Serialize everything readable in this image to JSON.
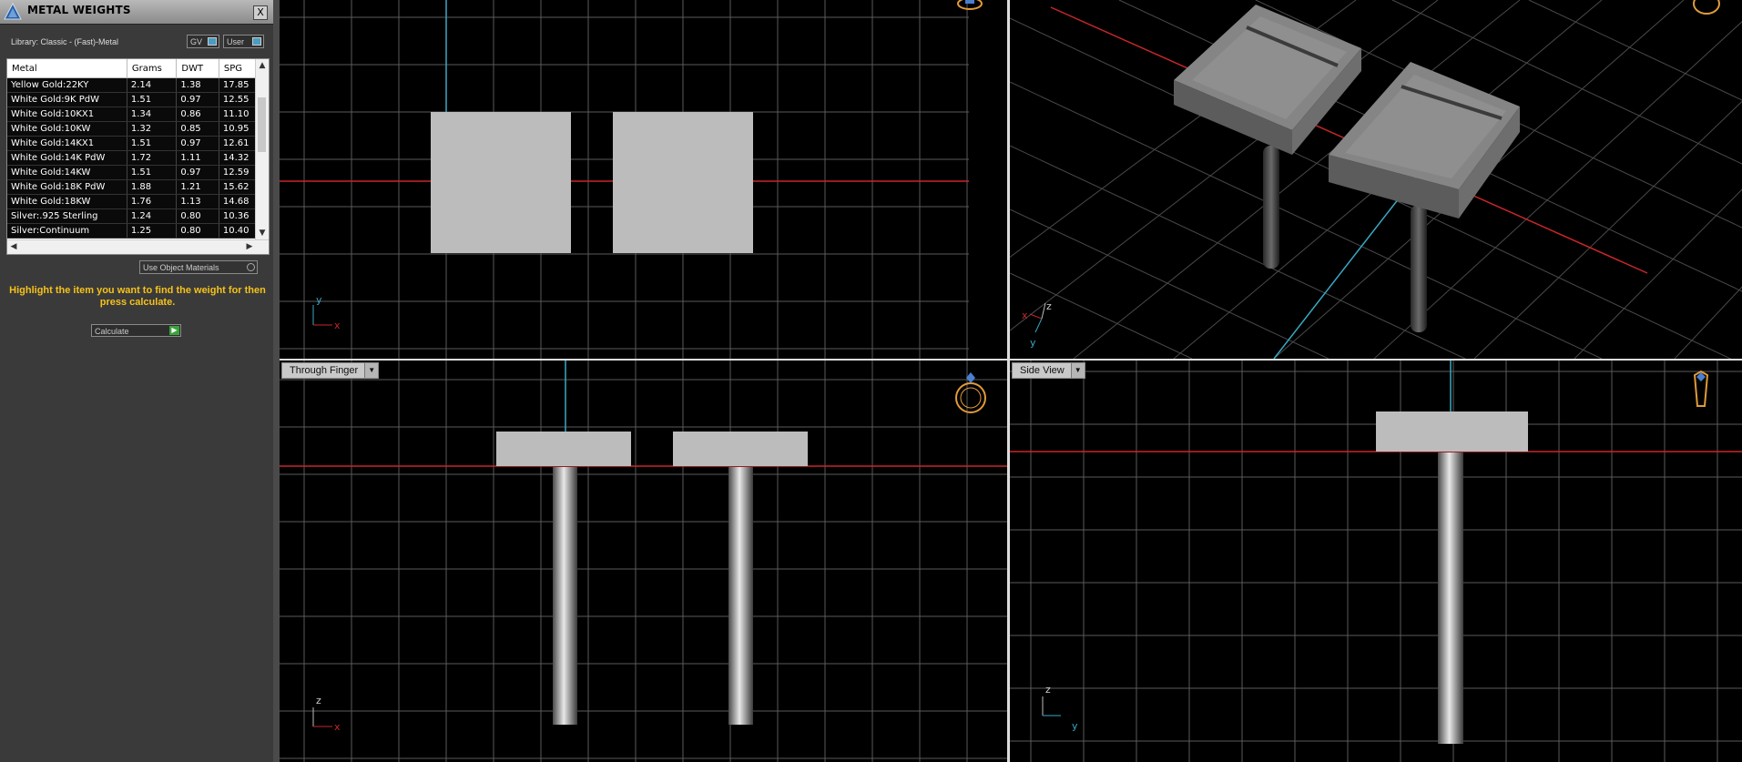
{
  "panel": {
    "title": "METAL WEIGHTS",
    "close_glyph": "X",
    "library": "Library: Classic - (Fast)-Metal",
    "gv_label": "GV",
    "user_label": "User",
    "columns": [
      "Metal",
      "Grams",
      "DWT",
      "SPG"
    ],
    "rows": [
      [
        "Yellow Gold:22KY",
        "2.14",
        "1.38",
        "17.85"
      ],
      [
        "White Gold:9K PdW",
        "1.51",
        "0.97",
        "12.55"
      ],
      [
        "White Gold:10KX1",
        "1.34",
        "0.86",
        "11.10"
      ],
      [
        "White Gold:10KW",
        "1.32",
        "0.85",
        "10.95"
      ],
      [
        "White Gold:14KX1",
        "1.51",
        "0.97",
        "12.61"
      ],
      [
        "White Gold:14K PdW",
        "1.72",
        "1.11",
        "14.32"
      ],
      [
        "White Gold:14KW",
        "1.51",
        "0.97",
        "12.59"
      ],
      [
        "White Gold:18K PdW",
        "1.88",
        "1.21",
        "15.62"
      ],
      [
        "White Gold:18KW",
        "1.76",
        "1.13",
        "14.68"
      ],
      [
        "Silver:.925 Sterling",
        "1.24",
        "0.80",
        "10.36"
      ],
      [
        "Silver:Continuum",
        "1.25",
        "0.80",
        "10.40"
      ]
    ],
    "use_object_materials": "Use Object Materials",
    "hint": "Highlight the item you want to find the weight for then press calculate.",
    "calculate": "Calculate"
  },
  "viewports": {
    "front_label": "Through Finger",
    "side_label": "Side View",
    "axis_x": "x",
    "axis_y": "y",
    "axis_z": "z"
  },
  "icons": [
    "app-logo-icon",
    "close-icon",
    "ring-orientation-icon",
    "dropdown-arrow-icon",
    "scroll-arrow-icon",
    "play-icon"
  ],
  "colors": {
    "axis_red": "#c8262a",
    "axis_cyan": "#3aa8c4",
    "grid": "#5a5a5a",
    "hint": "#f5c21b",
    "object_gray": "#bcbcbc"
  }
}
